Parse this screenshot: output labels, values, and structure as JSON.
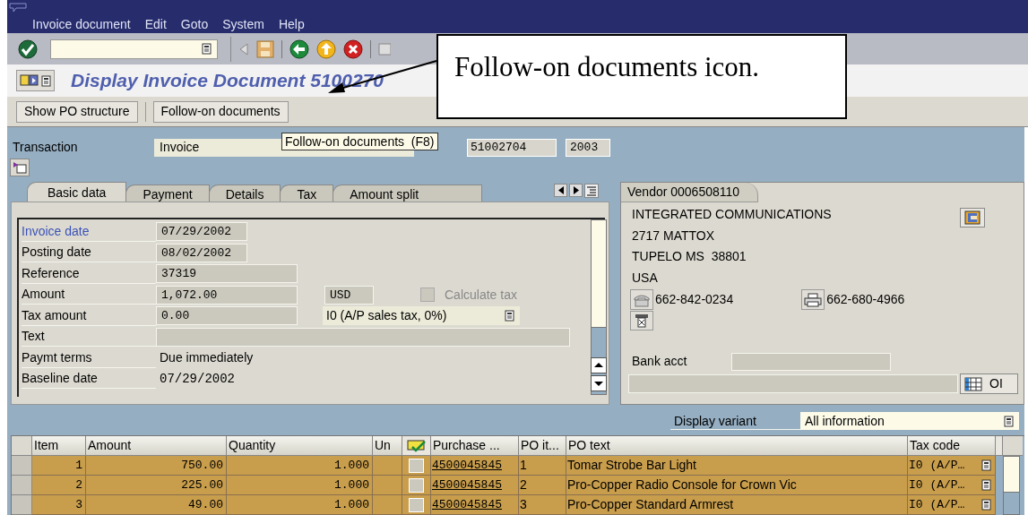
{
  "menu": [
    "Invoice document",
    "Edit",
    "Goto",
    "System",
    "Help"
  ],
  "title": "Display Invoice Document 5100270",
  "app_buttons": [
    "Show PO structure",
    "Follow-on documents"
  ],
  "tooltip": "Follow-on documents  (F8)",
  "transaction": {
    "label": "Transaction",
    "value": "Invoice",
    "document": "51002704",
    "year": "2003"
  },
  "tabs": [
    {
      "label": "Basic data",
      "selected": true
    },
    {
      "label": "Payment",
      "selected": false
    },
    {
      "label": "Details",
      "selected": false
    },
    {
      "label": "Tax",
      "selected": false
    },
    {
      "label": "Amount split",
      "selected": false
    }
  ],
  "form": [
    {
      "label": "Invoice date",
      "kind": "date",
      "value": "07/29/2002",
      "highlighted": true
    },
    {
      "label": "Posting date",
      "kind": "date",
      "value": "08/02/2002",
      "highlighted": false
    },
    {
      "label": "Reference",
      "kind": "field",
      "value": "37319",
      "highlighted": false
    },
    {
      "label": "Amount",
      "kind": "field",
      "value": "1,072.00",
      "highlighted": false,
      "currency": "USD",
      "checkbox": {
        "label": "Calculate tax",
        "checked": false,
        "disabled": true
      }
    },
    {
      "label": "Tax amount",
      "kind": "field",
      "value": "0.00",
      "highlighted": false,
      "tax_code": "I0 (A/P sales tax, 0%)"
    },
    {
      "label": "Text",
      "kind": "wide",
      "highlighted": false
    },
    {
      "label": "Paymt terms",
      "kind": "plain",
      "value": "Due immediately",
      "highlighted": false
    },
    {
      "label": "Baseline date",
      "kind": "plain",
      "value": "07/29/2002",
      "highlighted": false
    }
  ],
  "vendor": {
    "tab": "Vendor 0006508110",
    "lines": [
      "INTEGRATED COMMUNICATIONS",
      "2717 MATTOX",
      "TUPELO MS  38801",
      "USA"
    ],
    "phone": "662-842-0234",
    "fax": "662-680-4966",
    "bank_label": "Bank acct",
    "button": "OI"
  },
  "display_variant": {
    "label": "Display variant",
    "value": "All information"
  },
  "table": {
    "columns": [
      "Item",
      "Amount",
      "Quantity",
      "Un",
      "Purchase ...",
      "PO it...",
      "PO text",
      "Tax code"
    ],
    "rows": [
      {
        "item": "1",
        "amount": "750.00",
        "quantity": "1.000",
        "checked": false,
        "po": "4500045845",
        "po_item": "1",
        "po_text": "Tomar Strobe Bar Light",
        "tax_code": "I0 (A/P…"
      },
      {
        "item": "2",
        "amount": "225.00",
        "quantity": "1.000",
        "checked": false,
        "po": "4500045845",
        "po_item": "2",
        "po_text": "Pro-Copper Radio Console for Crown Vic",
        "tax_code": "I0 (A/P…"
      },
      {
        "item": "3",
        "amount": "49.00",
        "quantity": "1.000",
        "checked": false,
        "po": "4500045845",
        "po_item": "3",
        "po_text": "Pro-Copper Standard Armrest",
        "tax_code": "I0 (A/P…"
      }
    ]
  },
  "callout": "Follow-on documents icon."
}
